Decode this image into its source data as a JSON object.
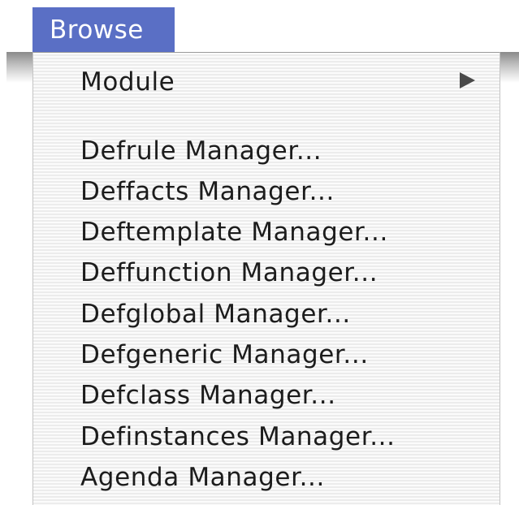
{
  "menubar": {
    "title": "Browse",
    "highlight_color": "#5a6fc5"
  },
  "menu": {
    "module": {
      "label": "Module",
      "submenu_icon": "triangle-right-icon"
    },
    "items": [
      {
        "label": "Defrule Manager..."
      },
      {
        "label": "Deffacts Manager..."
      },
      {
        "label": "Deftemplate Manager..."
      },
      {
        "label": "Deffunction Manager..."
      },
      {
        "label": "Defglobal Manager..."
      },
      {
        "label": "Defgeneric Manager..."
      },
      {
        "label": "Defclass Manager..."
      },
      {
        "label": "Definstances Manager..."
      },
      {
        "label": "Agenda Manager..."
      }
    ]
  }
}
